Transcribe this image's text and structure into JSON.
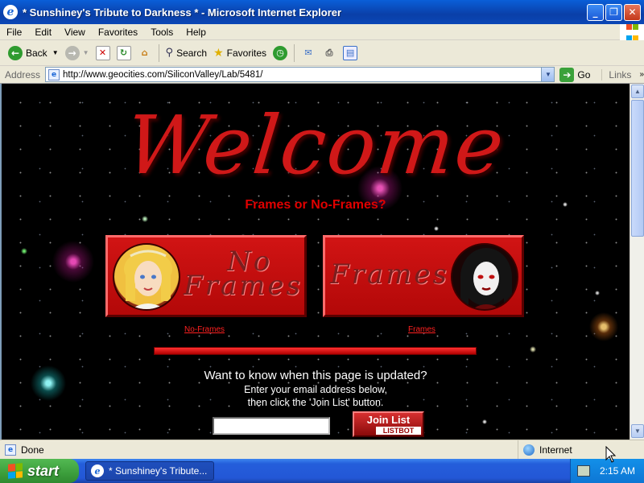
{
  "window": {
    "title": "* Sunshiney's Tribute to Darkness * - Microsoft Internet Explorer",
    "minimize": "_",
    "maximize": "❐",
    "close": "✕"
  },
  "menu": [
    "File",
    "Edit",
    "View",
    "Favorites",
    "Tools",
    "Help"
  ],
  "toolbar": {
    "back_label": "Back",
    "search_label": "Search",
    "favorites_label": "Favorites"
  },
  "address": {
    "label": "Address",
    "url": "http://www.geocities.com/SiliconValley/Lab/5481/",
    "go_label": "Go",
    "links_label": "Links"
  },
  "page": {
    "heading": "Welcome",
    "subtitle": "Frames or No-Frames?",
    "noframes_image_text_1": "No",
    "noframes_image_text_2": "Frames",
    "frames_image_text": "Frames",
    "noframes_link": "No-Frames",
    "frames_link": "Frames",
    "mail_heading": "Want to know when this page is updated?",
    "mail_line1": "Enter your email address below,",
    "mail_line2": "then click the 'Join List' button.",
    "email_value": "",
    "join_label": "Join List",
    "join_sub": "LISTBOT"
  },
  "status": {
    "text": "Done",
    "zone": "Internet"
  },
  "taskbar": {
    "start_label": "start",
    "task_label": "* Sunshiney's Tribute...",
    "clock": "2:15 AM"
  },
  "colors": {
    "accent_red": "#d01818",
    "xp_blue": "#245edb",
    "start_green": "#3c9e3c"
  }
}
